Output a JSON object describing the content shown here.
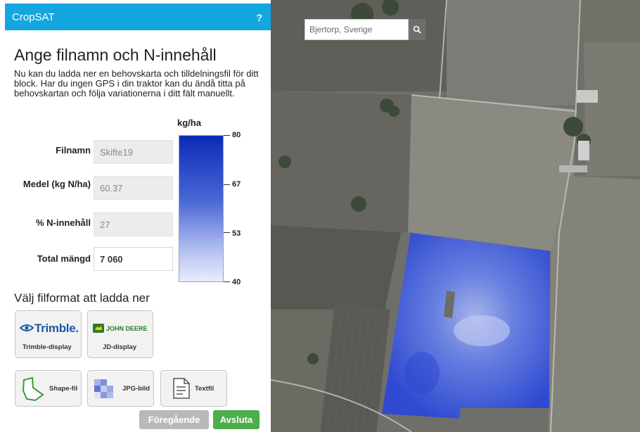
{
  "app": {
    "title": "CropSAT",
    "help_label": "?"
  },
  "heading": "Ange filnamn och N-innehåll",
  "intro": "Nu kan du ladda ner en behovskarta och tilldelningsfil för ditt block. Har du ingen GPS i din traktor kan du ändå titta på behovskartan och följa variationerna i ditt fält manuellt.",
  "fields": {
    "filename": {
      "label": "Filnamn",
      "value": "Skifte19"
    },
    "mean": {
      "label": "Medel (kg N/ha)",
      "value": "60.37"
    },
    "n_content": {
      "label": "% N-innehåll",
      "value": "27"
    },
    "total": {
      "label": "Total mängd",
      "value": "7 060"
    }
  },
  "legend": {
    "unit": "kg/ha",
    "ticks": [
      "80",
      "67",
      "53",
      "40"
    ],
    "color_top": "#0b2bb8",
    "color_bottom": "#e9edfc"
  },
  "format_heading": "Välj filformat att ladda ner",
  "formats": {
    "trimble": {
      "logo": "Trimble.",
      "label": "Trimble-display"
    },
    "jd": {
      "logo": "JOHN DEERE",
      "label": "JD-display"
    },
    "shape": {
      "label": "Shape-fil"
    },
    "jpg": {
      "label": "JPG-bild"
    },
    "text": {
      "label": "Textfil"
    }
  },
  "nav": {
    "prev": "Föregående",
    "finish": "Avsluta"
  },
  "map": {
    "search_value": "Bjertorp, Sverige",
    "search_icon": "magnifier-icon"
  },
  "colors": {
    "accent": "#14a6df",
    "finish": "#4cae4c",
    "prev": "#b9b9b9",
    "field_overlay": "#3a55e0"
  }
}
